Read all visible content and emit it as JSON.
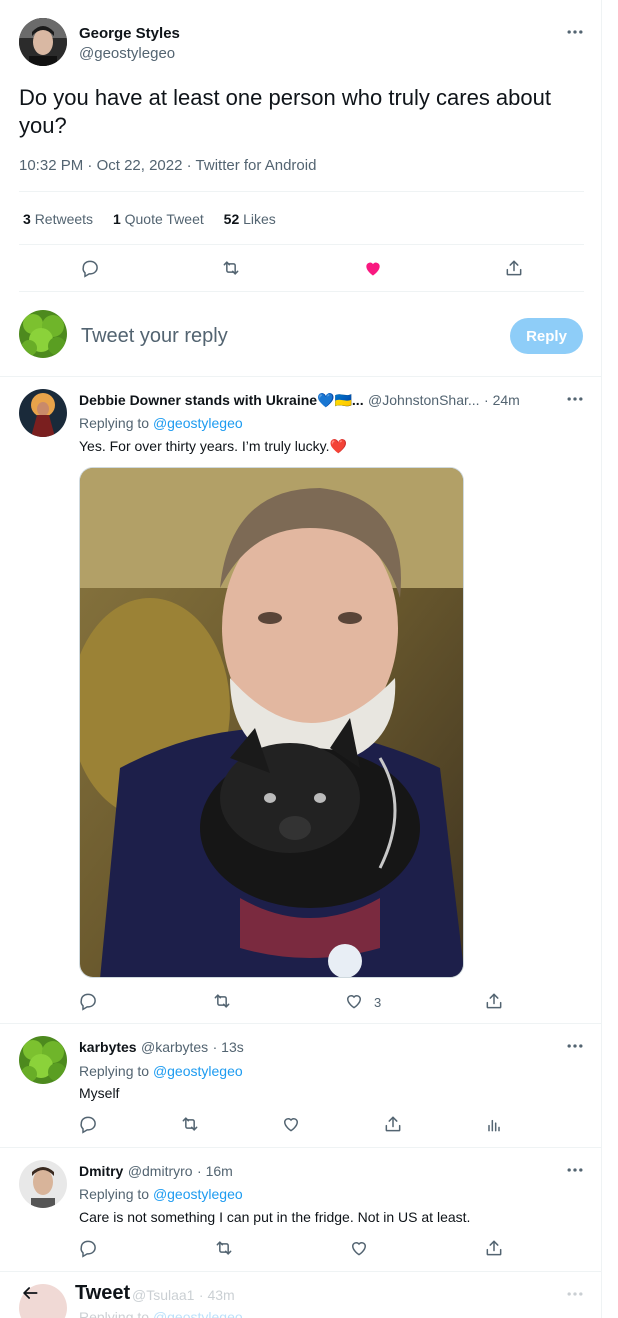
{
  "main_tweet": {
    "author_name": "George Styles",
    "author_handle": "@geostylegeo",
    "text": "Do you have at least one person who truly cares about you?",
    "time": "10:32 PM",
    "date": "Oct 22, 2022",
    "source": "Twitter for Android",
    "dot1": "·",
    "dot2": "·",
    "stats": {
      "retweets_count": "3",
      "retweets_label": "Retweets",
      "quotes_count": "1",
      "quotes_label": "Quote Tweet",
      "likes_count": "52",
      "likes_label": "Likes"
    },
    "liked": true,
    "like_color": "#f91880"
  },
  "composer": {
    "placeholder": "Tweet your reply",
    "reply_button": "Reply",
    "reply_button_color": "#8ecdf8"
  },
  "replies": [
    {
      "author_name": "Debbie Downer stands with Ukraine💙🇺🇦...",
      "author_handle": "@JohnstonShar...",
      "time": "· 24m",
      "replying_label": "Replying to",
      "replying_handle": "@geostylegeo",
      "text": "Yes. For over thirty years. I’m truly lucky.",
      "text_emoji": "❤️",
      "has_image": true,
      "like_count": "3"
    },
    {
      "author_name": "karbytes",
      "author_handle": "@karbytes",
      "time": "· 13s",
      "replying_label": "Replying to",
      "replying_handle": "@geostylegeo",
      "text": "Myself"
    },
    {
      "author_name": "Dmitry",
      "author_handle": "@dmitryro",
      "time": "· 16m",
      "replying_label": "Replying to",
      "replying_handle": "@geostylegeo",
      "text": "Care is not something I can put in the fridge. Not in US at least."
    },
    {
      "author_handle": "@Tsulaa1",
      "time": "· 43m",
      "replying_label": "Replying to",
      "replying_handle": "@geostylegeo"
    }
  ],
  "header": {
    "title": "Tweet",
    "back_icon": "arrow-left-icon"
  },
  "colors": {
    "link": "#1d9bf0",
    "muted": "#536471",
    "border": "#eff3f4"
  }
}
